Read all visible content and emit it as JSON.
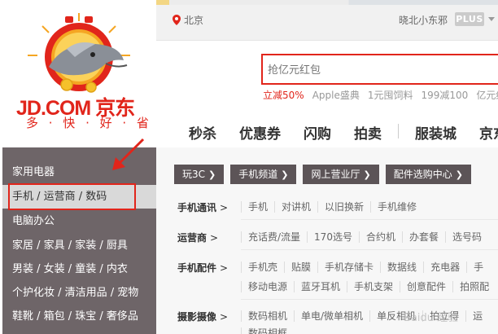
{
  "location": {
    "city": "北京"
  },
  "user": {
    "name": "晓北小东邪",
    "badge": "PLUS"
  },
  "logo": {
    "text": "JD.COM 京东",
    "slogan": "多 · 快 · 好 · 省"
  },
  "search": {
    "placeholder": "抢亿元红包"
  },
  "hotwords": [
    "立减50%",
    "Apple盛典",
    "1元囤饲料",
    "199减100",
    "亿元红"
  ],
  "mainnav": [
    "秒杀",
    "优惠券",
    "闪购",
    "拍卖",
    "服装城",
    "京东"
  ],
  "categories": [
    "家用电器",
    "手机 / 运营商 / 数码",
    "电脑办公",
    "家居 / 家具 / 家装 / 厨具",
    "男装 / 女装 / 童装 / 内衣",
    "个护化妆 / 清洁用品 / 宠物",
    "鞋靴 / 箱包 / 珠宝 / 奢侈品"
  ],
  "chips": [
    "玩3C",
    "手机频道",
    "网上营业厅",
    "配件选购中心"
  ],
  "rows": [
    {
      "head": "手机通讯",
      "links": [
        "手机",
        "对讲机",
        "以旧换新",
        "手机维修"
      ]
    },
    {
      "head": "运营商",
      "links": [
        "充话费/流量",
        "170选号",
        "合约机",
        "办套餐",
        "选号码"
      ]
    },
    {
      "head": "手机配件",
      "links": [
        "手机壳",
        "贴膜",
        "手机存储卡",
        "数据线",
        "充电器",
        "手"
      ],
      "links2": [
        "移动电源",
        "蓝牙耳机",
        "手机支架",
        "创意配件",
        "拍照配"
      ]
    },
    {
      "head": "摄影摄像",
      "links": [
        "数码相机",
        "单电/微单相机",
        "单反相机",
        "拍立得",
        "运"
      ],
      "links2": [
        "数码相框"
      ]
    }
  ],
  "watermark": "Baidu 经验",
  "colors": {
    "accent": "#e1251b",
    "menu_bg": "#6e6568",
    "chip_bg": "#5c5457"
  }
}
